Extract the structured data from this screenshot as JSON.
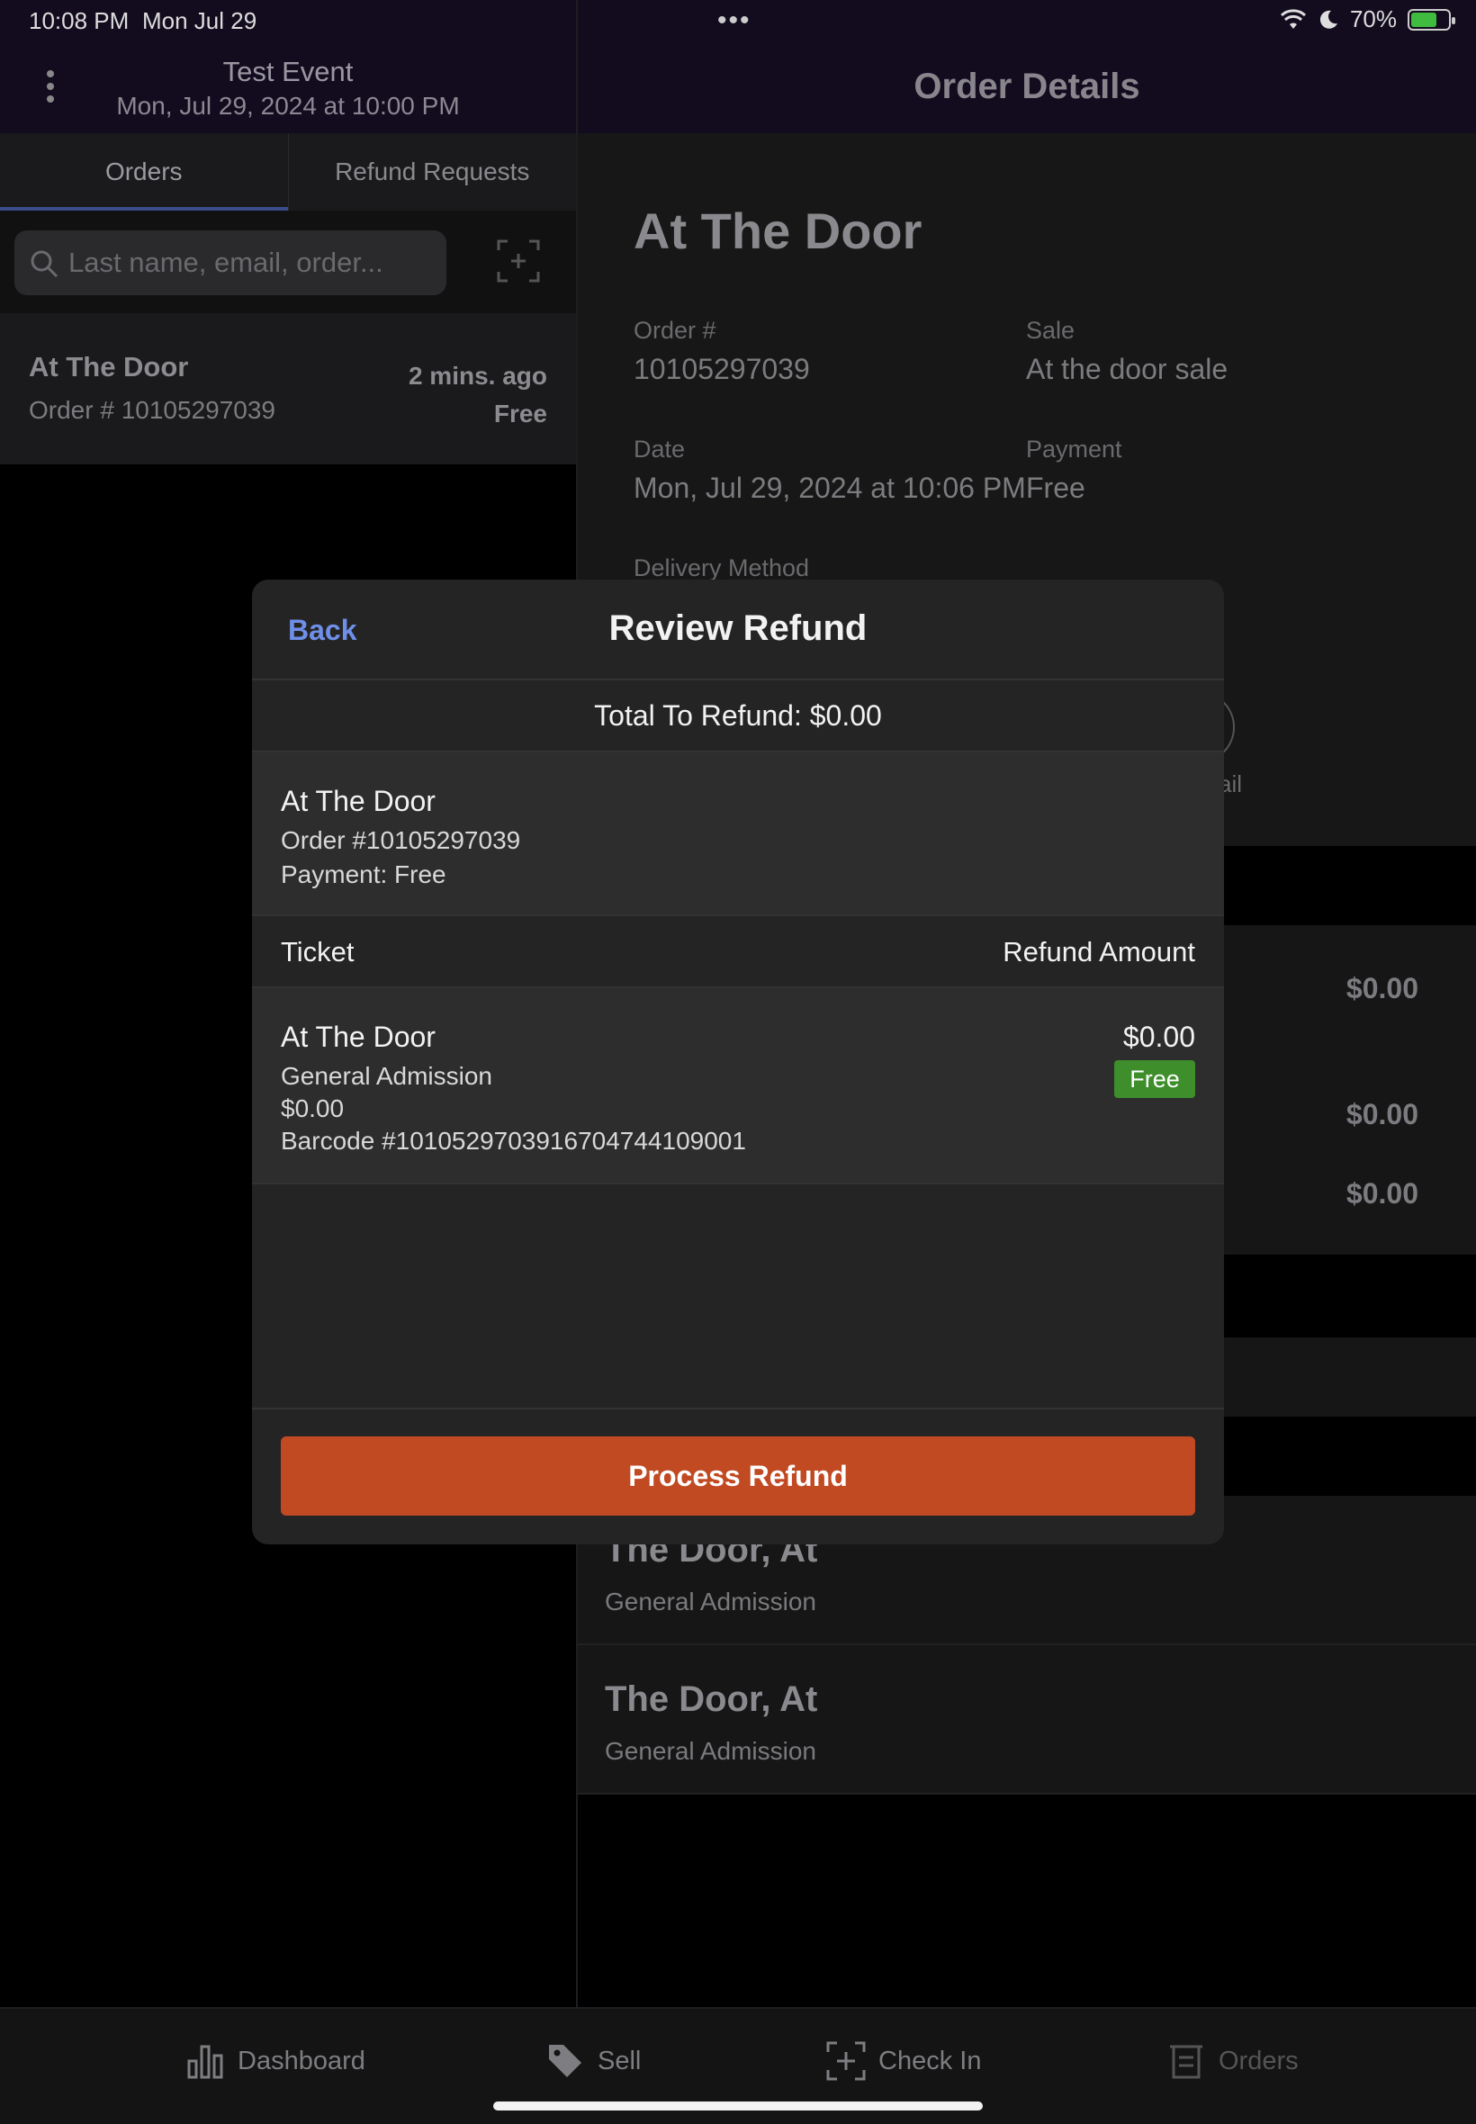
{
  "status_bar": {
    "time": "10:08 PM",
    "date": "Mon Jul 29",
    "battery": "70%",
    "battery_level": 0.7
  },
  "left_header": {
    "event_title": "Test Event",
    "event_date": "Mon, Jul 29, 2024 at 10:00 PM"
  },
  "right_header": {
    "title": "Order Details"
  },
  "tabs": [
    {
      "label": "Orders",
      "active": true
    },
    {
      "label": "Refund Requests",
      "active": false
    }
  ],
  "search": {
    "placeholder": "Last name, email, order..."
  },
  "order_list": [
    {
      "title": "At The Door",
      "order": "Order # 10105297039",
      "time": "2 mins. ago",
      "price": "Free"
    }
  ],
  "detail": {
    "title": "At The Door",
    "order_label": "Order #",
    "order_value": "10105297039",
    "sale_label": "Sale",
    "sale_value": "At the door sale",
    "date_label": "Date",
    "date_value": "Mon, Jul 29, 2024 at 10:06 PM",
    "payment_label": "Payment",
    "payment_value": "Free",
    "delivery_label": "Delivery Method",
    "email_partial": "ail",
    "amounts": [
      "$0.00",
      "$0.00",
      "$0.00"
    ],
    "attendees": [
      {
        "name": "The Door, At",
        "type": "General Admission"
      },
      {
        "name": "The Door, At",
        "type": "General Admission"
      }
    ]
  },
  "modal": {
    "back": "Back",
    "title": "Review Refund",
    "total": "Total To Refund: $0.00",
    "order_title": "At The Door",
    "order_number": "Order #10105297039",
    "payment": "Payment: Free",
    "col_ticket": "Ticket",
    "col_refund": "Refund Amount",
    "ticket": {
      "title": "At The Door",
      "type": "General Admission",
      "price": "$0.00",
      "barcode": "Barcode #101052970391670474410900​1",
      "amount": "$0.00",
      "badge": "Free"
    },
    "process_button": "Process Refund"
  },
  "tabbar": [
    {
      "label": "Dashboard",
      "icon": "bar-chart-icon"
    },
    {
      "label": "Sell",
      "icon": "tag-icon"
    },
    {
      "label": "Check In",
      "icon": "scan-icon"
    },
    {
      "label": "Orders",
      "icon": "orders-icon"
    }
  ],
  "colors": {
    "accent": "#6f8fe8",
    "process": "#c14a23",
    "free_badge": "#3e8e2c"
  }
}
